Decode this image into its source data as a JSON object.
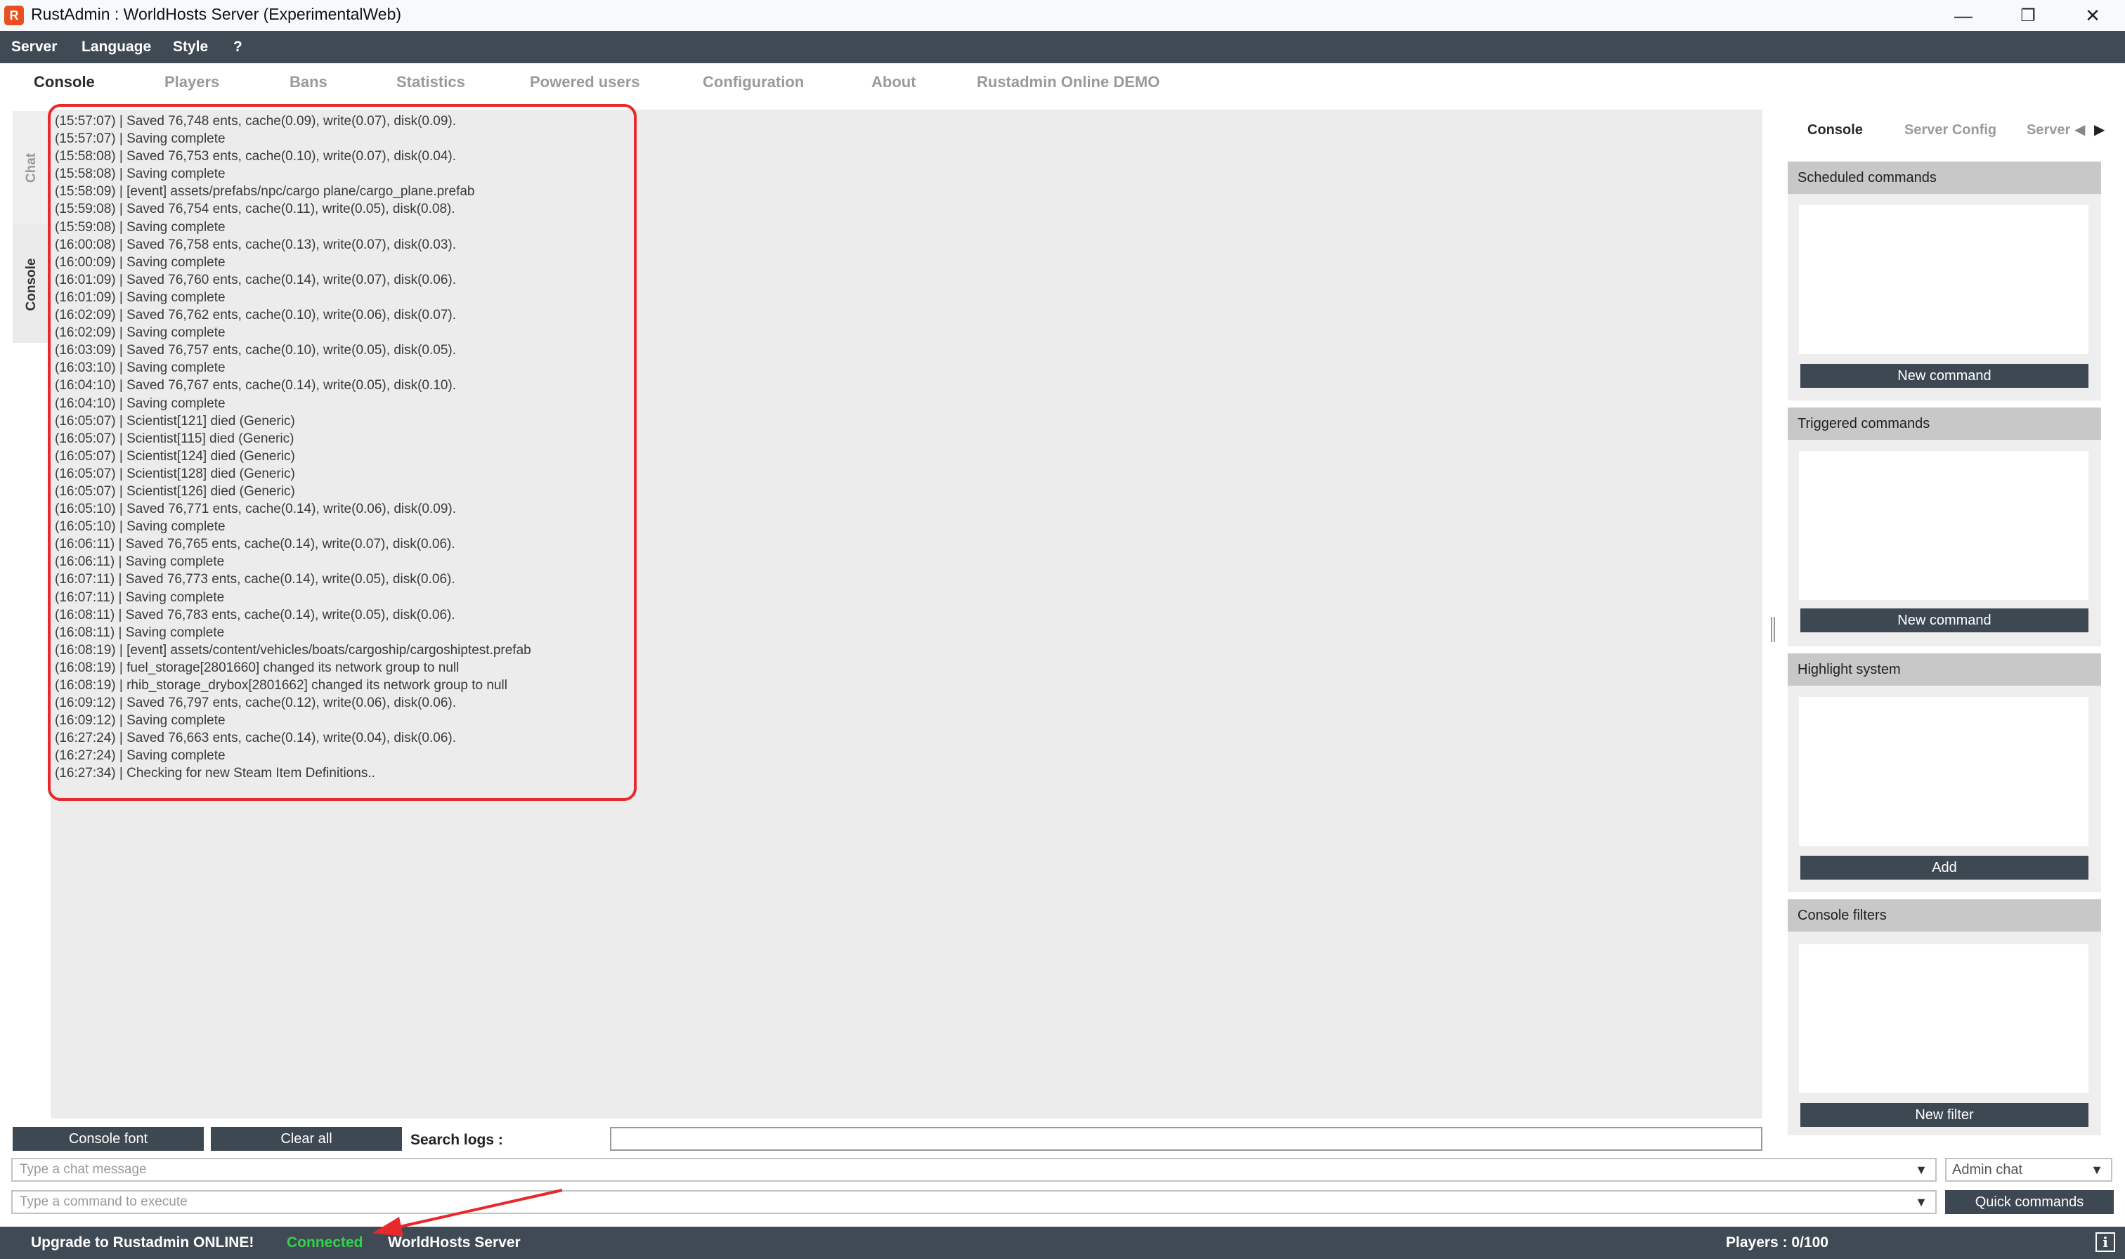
{
  "window": {
    "title": "RustAdmin  : WorldHosts Server (ExperimentalWeb)",
    "icon_glyph": "R",
    "controls": {
      "minimize": "—",
      "restore": "❐",
      "close": "✕"
    }
  },
  "menu": [
    "Server",
    "Language",
    "Style",
    "?"
  ],
  "tabs": [
    "Console",
    "Players",
    "Bans",
    "Statistics",
    "Powered users",
    "Configuration",
    "About",
    "Rustadmin Online DEMO"
  ],
  "side_tabs": [
    "Chat",
    "Console"
  ],
  "log_lines": [
    "(15:57:07) | Saved 76,748 ents, cache(0.09), write(0.07), disk(0.09).",
    "(15:57:07) | Saving complete",
    "(15:58:08) | Saved 76,753 ents, cache(0.10), write(0.07), disk(0.04).",
    "(15:58:08) | Saving complete",
    "(15:58:09) | [event] assets/prefabs/npc/cargo plane/cargo_plane.prefab",
    "(15:59:08) | Saved 76,754 ents, cache(0.11), write(0.05), disk(0.08).",
    "(15:59:08) | Saving complete",
    "(16:00:08) | Saved 76,758 ents, cache(0.13), write(0.07), disk(0.03).",
    "(16:00:09) | Saving complete",
    "(16:01:09) | Saved 76,760 ents, cache(0.14), write(0.07), disk(0.06).",
    "(16:01:09) | Saving complete",
    "(16:02:09) | Saved 76,762 ents, cache(0.10), write(0.06), disk(0.07).",
    "(16:02:09) | Saving complete",
    "(16:03:09) | Saved 76,757 ents, cache(0.10), write(0.05), disk(0.05).",
    "(16:03:10) | Saving complete",
    "(16:04:10) | Saved 76,767 ents, cache(0.14), write(0.05), disk(0.10).",
    "(16:04:10) | Saving complete",
    "(16:05:07) | Scientist[121] died (Generic)",
    "(16:05:07) | Scientist[115] died (Generic)",
    "(16:05:07) | Scientist[124] died (Generic)",
    "(16:05:07) | Scientist[128] died (Generic)",
    "(16:05:07) | Scientist[126] died (Generic)",
    "(16:05:10) | Saved 76,771 ents, cache(0.14), write(0.06), disk(0.09).",
    "(16:05:10) | Saving complete",
    "(16:06:11) | Saved 76,765 ents, cache(0.14), write(0.07), disk(0.06).",
    "(16:06:11) | Saving complete",
    "(16:07:11) | Saved 76,773 ents, cache(0.14), write(0.05), disk(0.06).",
    "(16:07:11) | Saving complete",
    "(16:08:11) | Saved 76,783 ents, cache(0.14), write(0.05), disk(0.06).",
    "(16:08:11) | Saving complete",
    "(16:08:19) | [event] assets/content/vehicles/boats/cargoship/cargoshiptest.prefab",
    "(16:08:19) | fuel_storage[2801660] changed its network group to null",
    "(16:08:19) | rhib_storage_drybox[2801662] changed its network group to null",
    "(16:09:12) | Saved 76,797 ents, cache(0.12), write(0.06), disk(0.06).",
    "(16:09:12) | Saving complete",
    "(16:27:24) | Saved 76,663 ents, cache(0.14), write(0.04), disk(0.06).",
    "(16:27:24) | Saving complete",
    "(16:27:34) | Checking for new Steam Item Definitions.."
  ],
  "right_tabs": [
    "Console",
    "Server Config",
    "Server"
  ],
  "right_tab_arrows": {
    "prev": "◀",
    "next": "▶"
  },
  "panels": [
    {
      "title": "Scheduled commands",
      "button": "New command"
    },
    {
      "title": "Triggered commands",
      "button": "New command"
    },
    {
      "title": "Highlight system",
      "button": "Add"
    },
    {
      "title": "Console filters",
      "button": "New filter"
    }
  ],
  "controls": {
    "console_font": "Console font",
    "clear_all": "Clear all",
    "search_label": "Search logs :",
    "search_value": "",
    "chat_placeholder": "Type a chat message",
    "command_placeholder": "Type a command to execute",
    "chat_target": "Admin chat",
    "quick_commands": "Quick commands",
    "dropdown_arrow": "▼"
  },
  "status": {
    "upgrade": "Upgrade to Rustadmin ONLINE!",
    "connection": "Connected",
    "server": "WorldHosts Server",
    "players": "Players : 0/100",
    "info_icon": "i"
  },
  "colors": {
    "bar": "#3f4a55",
    "button": "#3d4852",
    "connected": "#33d24a",
    "annotation": "#e8282b"
  }
}
